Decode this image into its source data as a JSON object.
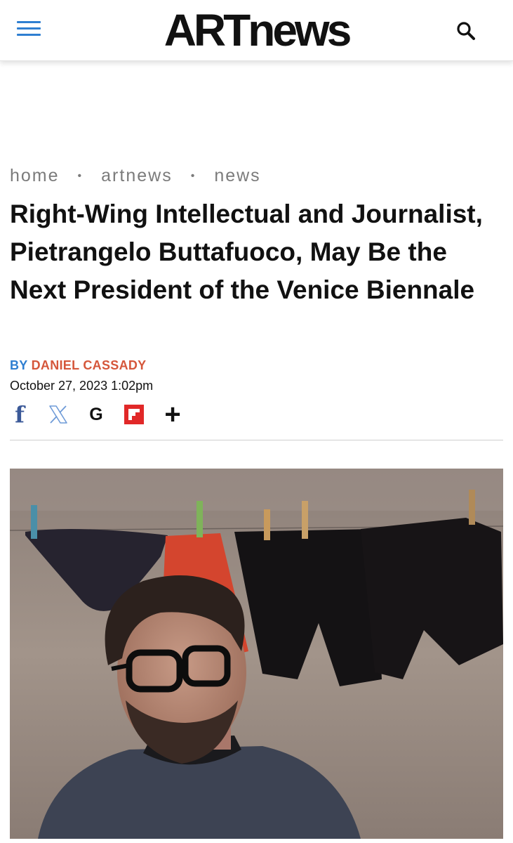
{
  "header": {
    "logo": "ARTnews",
    "menu_icon": "hamburger-icon",
    "search_icon": "search-icon",
    "accent_color": "#2f7fd1"
  },
  "breadcrumb": {
    "items": [
      "home",
      "artnews",
      "news"
    ]
  },
  "article": {
    "title": "Right-Wing Intellectual and Journalist, Pietrangelo Buttafuoco, May Be the Next President of the Venice Biennale",
    "by_label": "BY",
    "author": "DANIEL CASSADY",
    "author_color": "#d5573b",
    "date": "October 27, 2023 1:02pm"
  },
  "share": {
    "icons": [
      "facebook-icon",
      "x-icon",
      "google-icon",
      "flipboard-icon",
      "plus-icon"
    ],
    "facebook_glyph": "f",
    "google_glyph": "G",
    "plus_glyph": "+"
  },
  "hero_image": {
    "subject": "photo"
  }
}
